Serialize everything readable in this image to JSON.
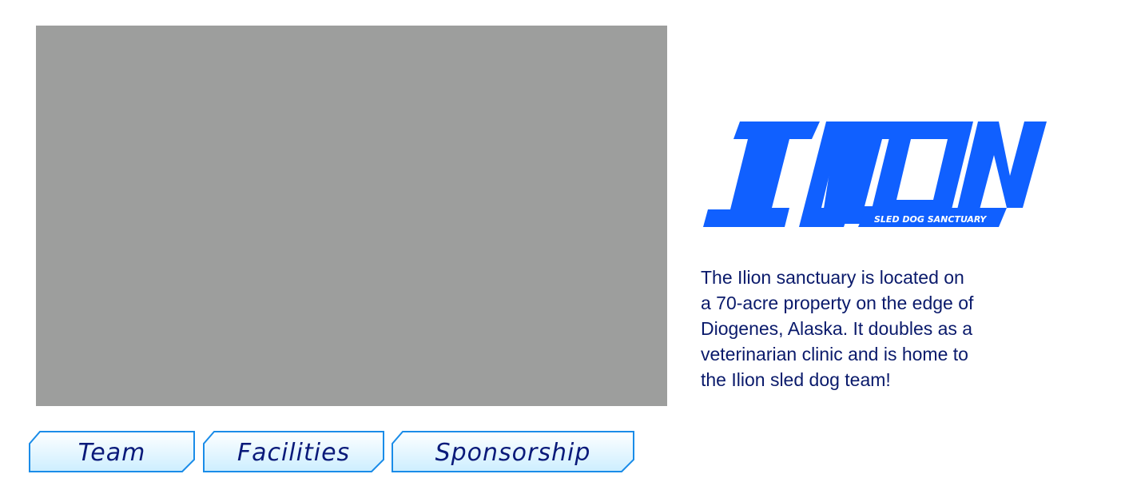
{
  "hero": {
    "image": "image-placeholder"
  },
  "logo": {
    "title": "ILION",
    "tagline": "SLED DOG SANCTUARY",
    "color": "#1060ff"
  },
  "description": {
    "lines": [
      "The Ilion sanctuary is located on",
      "a 70-acre property on the edge of",
      "Diogenes, Alaska. It doubles as a",
      "veterinarian clinic and is home to",
      "the Ilion sled dog team!"
    ]
  },
  "nav": {
    "buttons": [
      {
        "label": "Team"
      },
      {
        "label": "Facilities"
      },
      {
        "label": "Sponsorship"
      }
    ]
  },
  "colors": {
    "placeholder": "#9d9e9d",
    "text": "#0a1a6b",
    "button_border": "#1a8ce8",
    "button_fill_top": "#ffffff",
    "button_fill_bottom": "#cdeeff"
  }
}
